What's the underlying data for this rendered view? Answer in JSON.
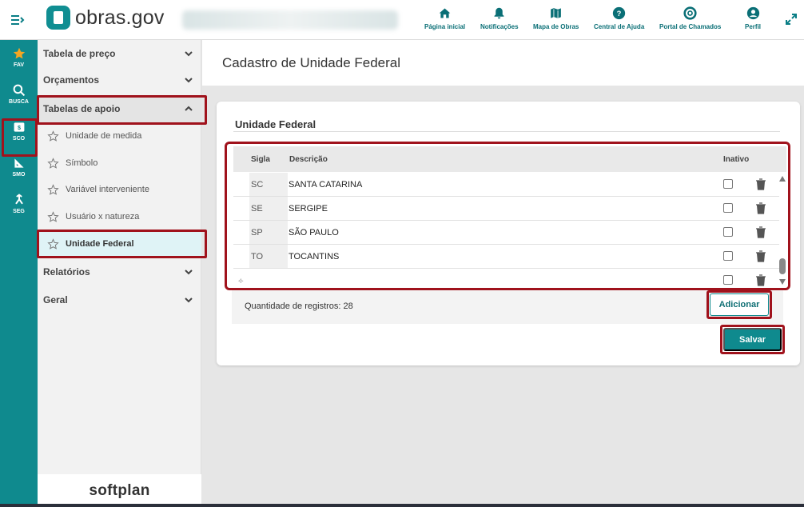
{
  "header": {
    "logo_text": "obras.gov",
    "nav": [
      {
        "label": "Página inicial",
        "icon": "home-icon"
      },
      {
        "label": "Notificações",
        "icon": "bell-icon"
      },
      {
        "label": "Mapa de Obras",
        "icon": "map-icon"
      },
      {
        "label": "Central de Ajuda",
        "icon": "help-icon"
      },
      {
        "label": "Portal de Chamados",
        "icon": "lifebuoy-icon"
      },
      {
        "label": "Perfil",
        "icon": "user-icon"
      }
    ]
  },
  "rail": [
    {
      "label": "FAV",
      "icon": "star-icon"
    },
    {
      "label": "BUSCA",
      "icon": "search-icon"
    },
    {
      "label": "SCO",
      "icon": "sco-icon"
    },
    {
      "label": "SMO",
      "icon": "ruler-icon"
    },
    {
      "label": "SEG",
      "icon": "merge-icon"
    }
  ],
  "sidebar": {
    "groups": [
      {
        "label": "Tabela de preço"
      },
      {
        "label": "Orçamentos"
      },
      {
        "label": "Tabelas de apoio"
      },
      {
        "label": "Relatórios"
      },
      {
        "label": "Geral"
      }
    ],
    "sub_items": [
      {
        "label": "Unidade de medida"
      },
      {
        "label": "Símbolo"
      },
      {
        "label": "Variável interveniente"
      },
      {
        "label": "Usuário x natureza"
      },
      {
        "label": "Unidade Federal"
      }
    ],
    "footer": "softplan"
  },
  "page": {
    "title": "Cadastro de Unidade Federal",
    "card_title": "Unidade Federal"
  },
  "grid": {
    "columns": {
      "sigla": "Sigla",
      "descricao": "Descrição",
      "inativo": "Inativo"
    },
    "rows": [
      {
        "sigla": "SC",
        "descricao": "SANTA CATARINA",
        "inativo": false
      },
      {
        "sigla": "SE",
        "descricao": "SERGIPE",
        "inativo": false
      },
      {
        "sigla": "SP",
        "descricao": "SÃO PAULO",
        "inativo": false
      },
      {
        "sigla": "TO",
        "descricao": "TOCANTINS",
        "inativo": false
      },
      {
        "sigla": "",
        "descricao": "",
        "inativo": false
      }
    ],
    "new_row_marker": "⟡",
    "count_label": "Quantidade de registros: 28"
  },
  "buttons": {
    "add": "Adicionar",
    "save": "Salvar"
  },
  "colors": {
    "primary": "#0f8a8e",
    "highlight": "#a0121c"
  }
}
